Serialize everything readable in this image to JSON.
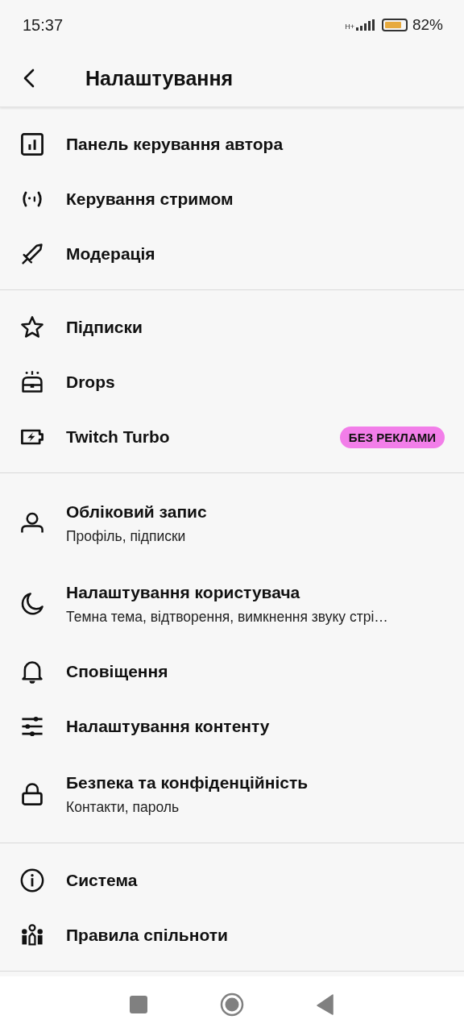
{
  "status_bar": {
    "time": "15:37",
    "network": "H+",
    "battery": "82%"
  },
  "header": {
    "title": "Налаштування"
  },
  "sections": [
    {
      "items": [
        {
          "title": "Панель керування автора"
        },
        {
          "title": "Керування стримом"
        },
        {
          "title": "Модерація"
        }
      ]
    },
    {
      "items": [
        {
          "title": "Підписки"
        },
        {
          "title": "Drops"
        },
        {
          "title": "Twitch Turbo",
          "badge": "БЕЗ РЕКЛАМИ"
        }
      ]
    },
    {
      "items": [
        {
          "title": "Обліковий запис",
          "subtitle": "Профіль, підписки"
        },
        {
          "title": "Налаштування користувача",
          "subtitle": "Темна тема, відтворення, вимкнення звуку стрі…"
        },
        {
          "title": "Сповіщення"
        },
        {
          "title": "Налаштування контенту"
        },
        {
          "title": "Безпека та конфіденційність",
          "subtitle": "Контакти, пароль"
        }
      ]
    },
    {
      "items": [
        {
          "title": "Система"
        },
        {
          "title": "Правила спільноти"
        }
      ]
    }
  ]
}
